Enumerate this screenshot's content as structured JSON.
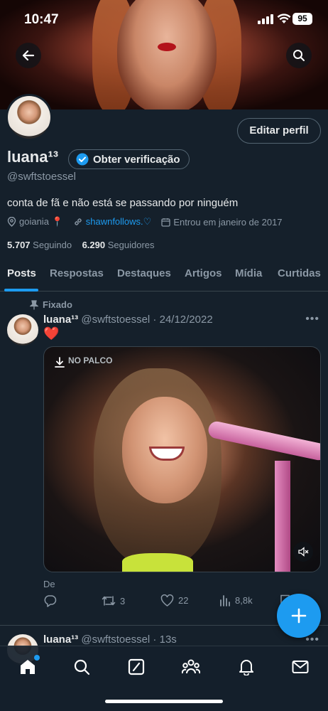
{
  "status_bar": {
    "time": "10:47",
    "battery": "95"
  },
  "profile": {
    "name": "luana¹³",
    "verify_label": "Obter verificação",
    "handle": "@swftstoessel",
    "edit_label": "Editar perfil",
    "bio": "conta de fã e não está se passando por ninguém",
    "location": "goiania 📍",
    "website": "shawnfollows.♡",
    "joined": "Entrou em janeiro de 2017",
    "following_count": "5.707",
    "following_label": "Seguindo",
    "followers_count": "6.290",
    "followers_label": "Seguidores"
  },
  "tabs": [
    {
      "label": "Posts"
    },
    {
      "label": "Respostas"
    },
    {
      "label": "Destaques"
    },
    {
      "label": "Artigos"
    },
    {
      "label": "Mídia"
    },
    {
      "label": "Curtidas"
    }
  ],
  "posts": [
    {
      "pinned_label": "Fixado",
      "author": "luana¹³",
      "handle_date": "@swftstoessel · 24/12/2022",
      "text": "❤️",
      "media_overlay": "NO PALCO",
      "caption": "De",
      "replies": "",
      "reposts": "3",
      "likes": "22",
      "views": "8,8k"
    },
    {
      "author": "luana¹³",
      "handle_date": "@swftstoessel · 13s"
    }
  ],
  "colors": {
    "accent": "#1d9bf0",
    "background": "#15202b",
    "muted": "#8b98a5"
  },
  "icons": [
    "back-arrow-icon",
    "search-icon",
    "verified-badge-icon",
    "location-icon",
    "link-icon",
    "calendar-icon",
    "pin-icon",
    "reply-icon",
    "repost-icon",
    "like-icon",
    "views-icon",
    "share-icon",
    "compose-plus-icon",
    "home-icon",
    "grok-icon",
    "communities-icon",
    "notifications-icon",
    "messages-icon"
  ]
}
